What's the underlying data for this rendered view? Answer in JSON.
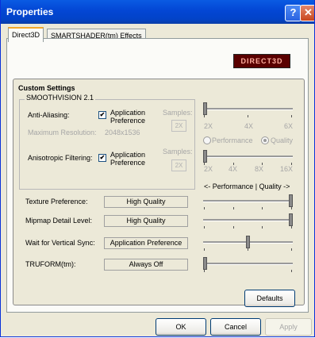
{
  "window": {
    "title": "Properties",
    "help_glyph": "?",
    "close_glyph": "✕"
  },
  "tabs": [
    "Direct3D",
    "SMARTSHADER(tm) Effects"
  ],
  "logo": {
    "text": "DIRECT3D",
    "color": "#5a0000"
  },
  "custom": {
    "heading": "Custom Settings",
    "smoothvision": "SMOOTHVISION 2.1",
    "aa": {
      "label": "Anti-Aliasing:",
      "checked": true,
      "option": "Application Preference",
      "max_res_label": "Maximum Resolution:",
      "max_res_value": "2048x1536",
      "samples_label": "Samples:",
      "samples_value": "2X",
      "scale": [
        "2X",
        "4X",
        "6X"
      ]
    },
    "modes": {
      "performance": "Performance",
      "quality": "Quality",
      "selected": "quality"
    },
    "af": {
      "label": "Anisotropic Filtering:",
      "checked": true,
      "option": "Application Preference",
      "samples_label": "Samples:",
      "samples_value": "2X",
      "scale": [
        "2X",
        "4X",
        "8X",
        "16X"
      ]
    },
    "perf_quality_label": "<- Performance  |  Quality ->",
    "rows": [
      {
        "label": "Texture Preference:",
        "value": "High Quality",
        "level": 1.0
      },
      {
        "label": "Mipmap Detail Level:",
        "value": "High Quality",
        "level": 1.0
      },
      {
        "label": "Wait for Vertical Sync:",
        "value": "Application Preference",
        "level": 0.5
      },
      {
        "label": "TRUFORM(tm):",
        "value": "Always Off",
        "level": 0.0
      }
    ]
  },
  "buttons": {
    "defaults": "Defaults",
    "ok": "OK",
    "cancel": "Cancel",
    "apply": "Apply"
  }
}
